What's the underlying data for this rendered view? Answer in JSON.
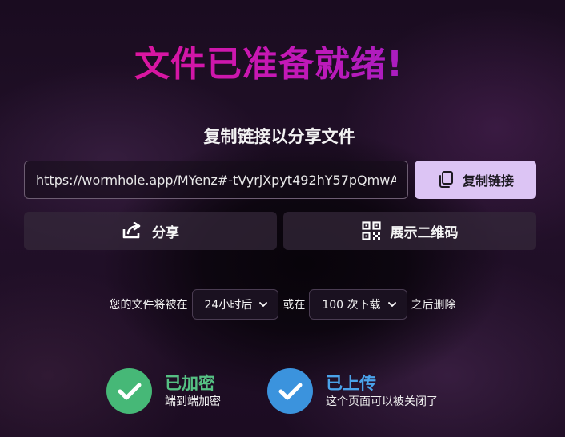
{
  "title": "文件已准备就绪!",
  "subtitle": "复制链接以分享文件",
  "link": {
    "value": "https://wormhole.app/MYenz#-tVyrjXpyt492hY57pQmwA"
  },
  "buttons": {
    "copy_label": "复制链接",
    "share_label": "分享",
    "qr_label": "展示二维码"
  },
  "expiry": {
    "prefix": "您的文件将被在",
    "time_value": "24小时后",
    "middle": "或在",
    "downloads_value": "100 次下载",
    "suffix": "之后删除"
  },
  "status": {
    "encrypted_title": "已加密",
    "encrypted_sub": "端到端加密",
    "uploaded_title": "已上传",
    "uploaded_sub": "这个页面可以被关闭了"
  },
  "colors": {
    "title_gradient_start": "#f0138a",
    "title_gradient_end": "#8a24c8",
    "copy_button_bg": "#dcc4f4",
    "encrypted_green": "#46b877",
    "uploaded_blue": "#3b93dd"
  },
  "icons": {
    "copy": "copy-icon",
    "share": "share-icon",
    "qr": "qr-code-icon",
    "chevron": "chevron-down-icon",
    "check": "check-icon"
  }
}
